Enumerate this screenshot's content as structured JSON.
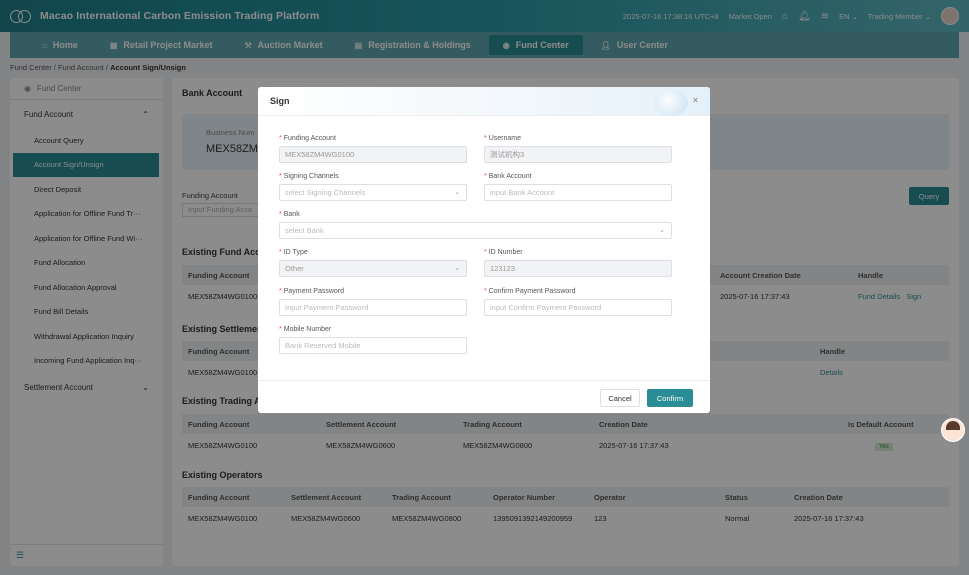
{
  "header": {
    "app_title": "Macao International Carbon Emission Trading Platform",
    "datetime": "2025-07-16 17:38:16 UTC+8",
    "market_status": "Market Open",
    "language": "EN",
    "user_role": "Trading Member"
  },
  "nav": {
    "tabs": [
      "Home",
      "Retail Project Market",
      "Auction Market",
      "Registration & Holdings",
      "Fund Center",
      "User Center"
    ],
    "active": "Fund Center"
  },
  "breadcrumb": [
    "Fund Center",
    "Fund Account",
    "Account Sign/Unsign"
  ],
  "sidebar": {
    "header": "Fund Center",
    "group1": "Fund Account",
    "items": [
      "Account Query",
      "Account Sign/Unsign",
      "Direct Deposit",
      "Application for Offline Fund Tr···",
      "Application for Offline Fund Wi···",
      "Fund Allocation",
      "Fund Allocation Approval",
      "Fund Bill Details",
      "Withdrawal Application Inquiry",
      "Incoming Fund Application Inq···"
    ],
    "group2": "Settlement Account"
  },
  "main": {
    "title": "Bank Account",
    "info_label": "Business Num",
    "info_value": "MEX58ZM4W",
    "filter_label": "Funding Account",
    "filter_placeholder": "Input Funding Acco",
    "query_label": "Query",
    "fund_section": {
      "title": "Existing Fund Acco",
      "headers": [
        "Funding Account",
        "Account Creation Date",
        "Handle"
      ],
      "row": [
        "MEX58ZM4WG0100",
        "2025-07-16 17:37:43"
      ],
      "actions": [
        "Fund Details",
        "Sign"
      ]
    },
    "settlement_section": {
      "title": "Existing Settlemer",
      "headers": [
        "Funding Account",
        "Handle"
      ],
      "row": [
        "MEX58ZM4WG0100"
      ],
      "action": "Details"
    },
    "trading_section": {
      "title": "Existing Trading Ac",
      "headers": [
        "Funding Account",
        "Settlement Account",
        "Trading Account",
        "Creation Date",
        "Is Default Account"
      ],
      "row": [
        "MEX58ZM4WG0100",
        "MEX58ZM4WG0600",
        "MEX58ZM4WG0800",
        "2025-07-16 17:37:43",
        "Yes"
      ]
    },
    "operators_section": {
      "title": "Existing Operators",
      "headers": [
        "Funding Account",
        "Settlement Account",
        "Trading Account",
        "Operator Number",
        "Operator",
        "Status",
        "Creation Date"
      ],
      "row": [
        "MEX58ZM4WG0100",
        "MEX58ZM4WG0600",
        "MEX58ZM4WG0800",
        "1395091392149200959",
        "123",
        "Normal",
        "2025-07-16 17:37:43"
      ]
    }
  },
  "modal": {
    "title": "Sign",
    "fields": {
      "funding_account": {
        "label": "Funding Account",
        "value": "MEX58ZM4WG0100"
      },
      "username": {
        "label": "Username",
        "value": "测试机构3"
      },
      "signing_channels": {
        "label": "Signing Channels",
        "placeholder": "select Signing Channels"
      },
      "bank_account": {
        "label": "Bank Account",
        "placeholder": "input Bank Account"
      },
      "bank": {
        "label": "Bank",
        "placeholder": "select Bank"
      },
      "id_type": {
        "label": "ID Type",
        "value": "Other"
      },
      "id_number": {
        "label": "ID Number",
        "value": "123123"
      },
      "payment_password": {
        "label": "Payment Password",
        "placeholder": "Input Payment Password"
      },
      "confirm_password": {
        "label": "Confirm Payment Password",
        "placeholder": "input Confirm Payment Password"
      },
      "mobile": {
        "label": "Mobile Number",
        "placeholder": "Bank Reserved Mobile"
      }
    },
    "cancel_label": "Cancel",
    "confirm_label": "Confirm",
    "close_glyph": "×"
  },
  "colors": {
    "primary": "#2a8c94",
    "required": "#e54545"
  }
}
